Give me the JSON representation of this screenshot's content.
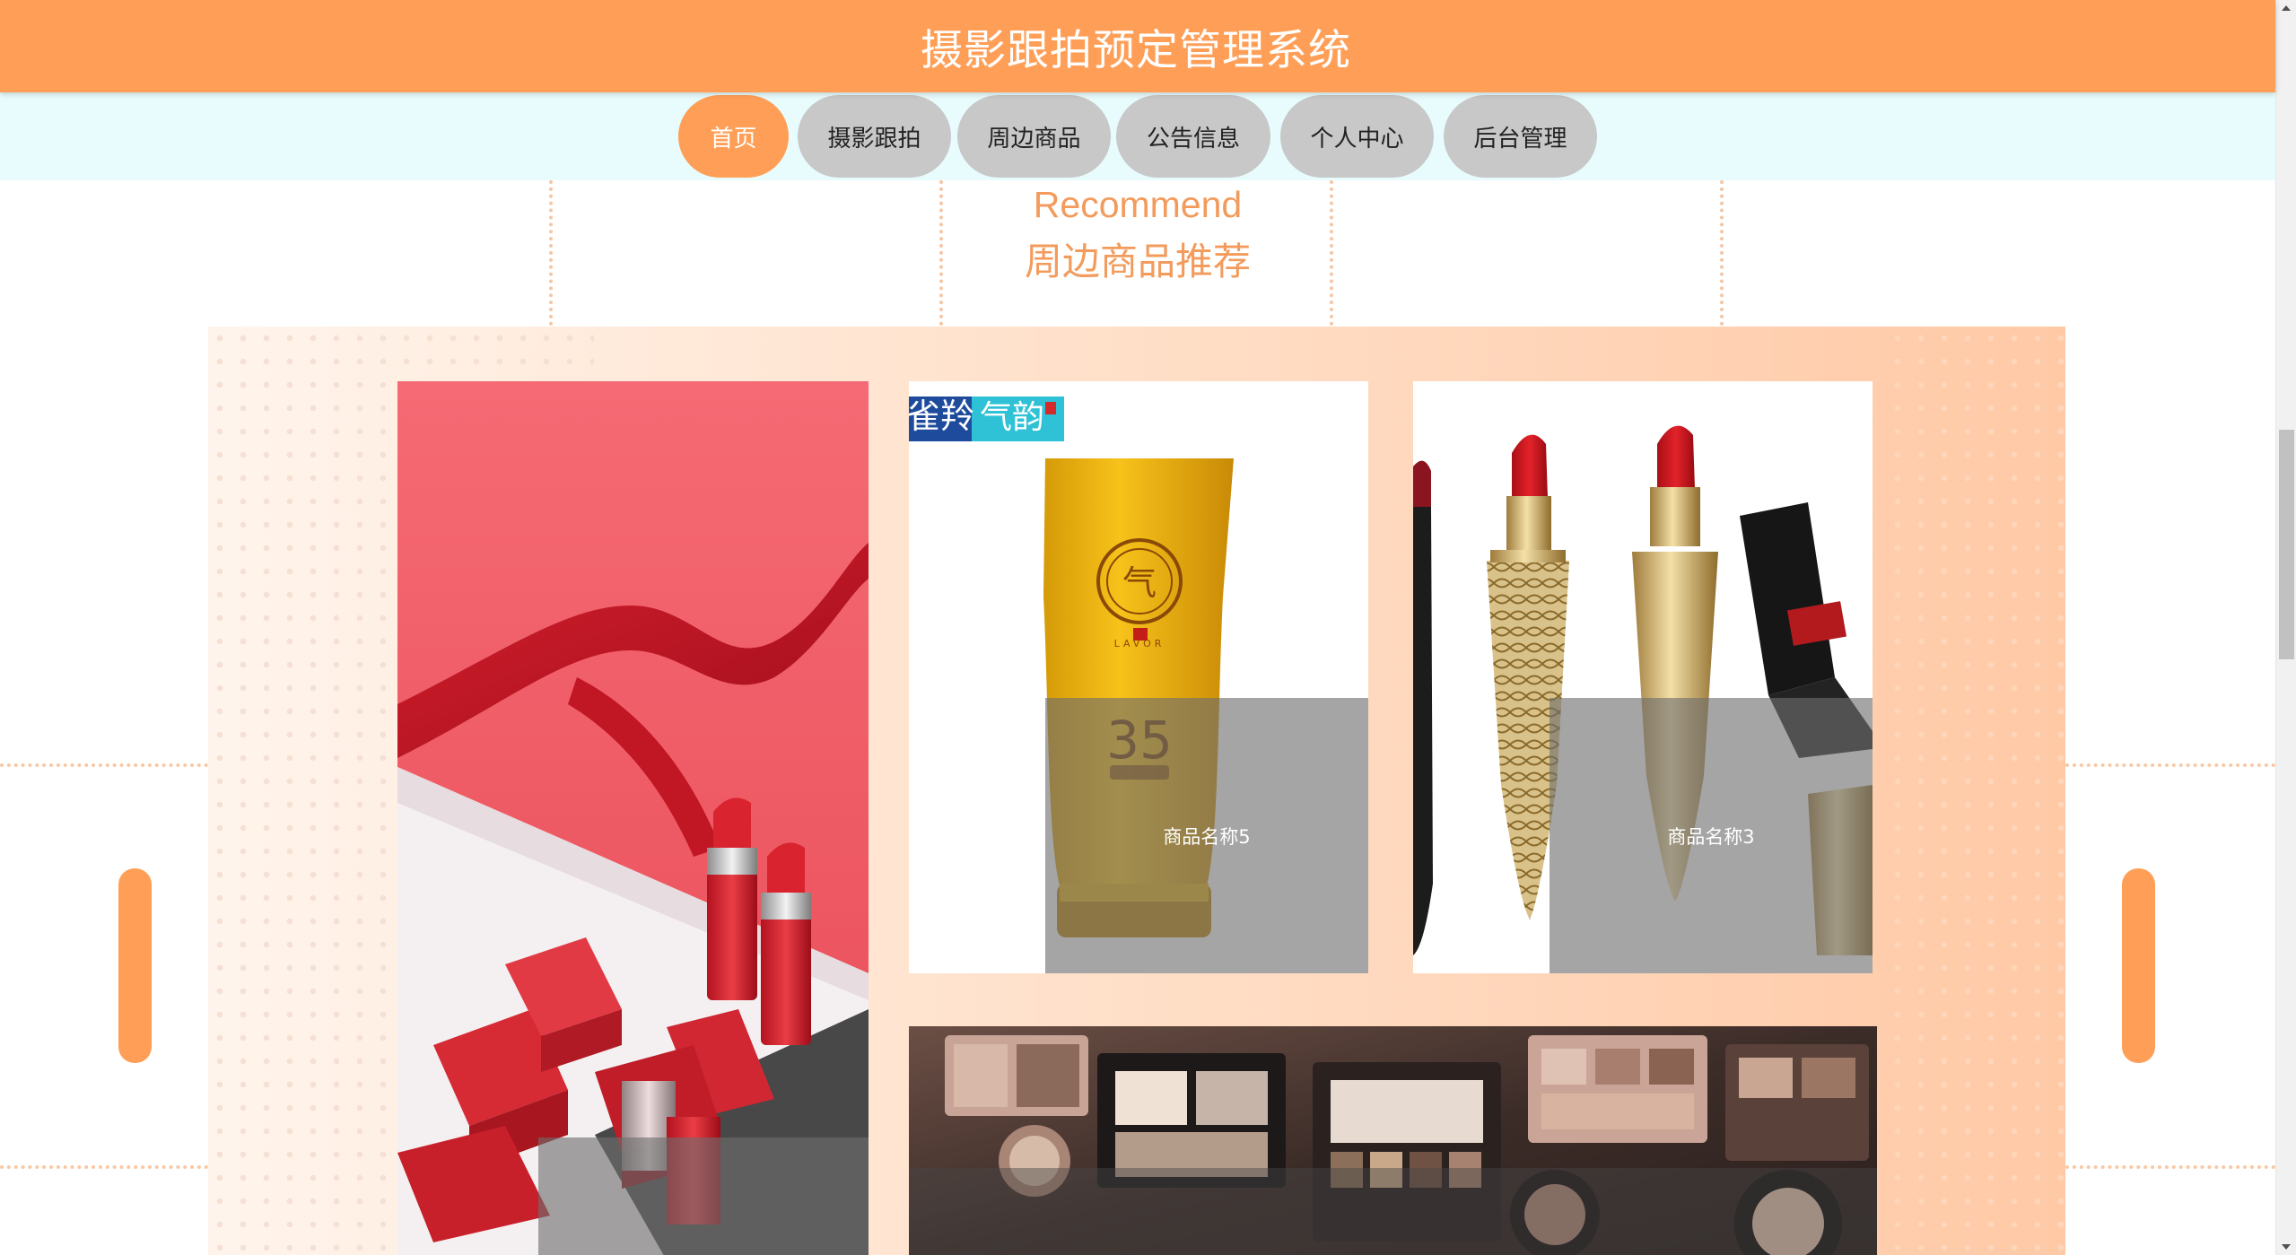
{
  "header": {
    "title": "摄影跟拍预定管理系统"
  },
  "nav": {
    "items": [
      {
        "label": "首页",
        "active": true
      },
      {
        "label": "摄影跟拍",
        "active": false
      },
      {
        "label": "周边商品",
        "active": false
      },
      {
        "label": "公告信息",
        "active": false
      },
      {
        "label": "个人中心",
        "active": false
      },
      {
        "label": "后台管理",
        "active": false
      }
    ]
  },
  "section": {
    "title_en": "Recommend",
    "title_cn": "周边商品推荐"
  },
  "products": {
    "card_lipstick_red": {
      "name": ""
    },
    "card_sunscreen": {
      "name": "商品名称5",
      "brand_text": "雀羚 气韵",
      "spf": "35"
    },
    "card_lipstick_gold": {
      "name": "商品名称3"
    },
    "card_eyeshadow": {
      "name": ""
    }
  },
  "colors": {
    "accent": "#ff9f57",
    "nav_bg": "#e8fcfd",
    "nav_inactive": "#c8c8c8",
    "section_title": "#f39b5c"
  }
}
